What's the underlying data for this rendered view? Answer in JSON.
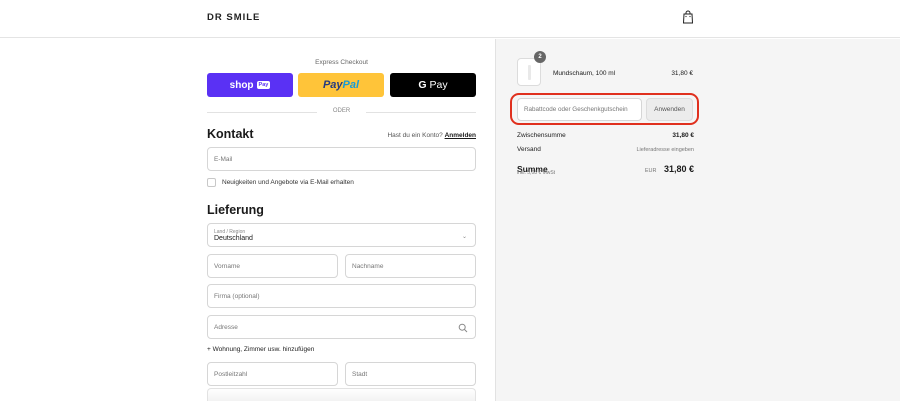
{
  "header": {
    "logo": "DR SMILE",
    "icon": "shopping-bag-icon"
  },
  "express": {
    "title": "Express Checkout",
    "shop_label": "shop",
    "shop_tag": "Pay",
    "paypal_a": "Pay",
    "paypal_b": "Pal",
    "gpay_g": "G",
    "gpay_label": "Pay",
    "divider": "ODER"
  },
  "contact": {
    "heading": "Kontakt",
    "login_prompt": "Hast du ein Konto?",
    "login_link": "Anmelden",
    "email_placeholder": "E-Mail",
    "newsletter_label": "Neuigkeiten und Angebote via E-Mail erhalten"
  },
  "delivery": {
    "heading": "Lieferung",
    "country_label": "Land / Region",
    "country_value": "Deutschland",
    "first_name": "Vorname",
    "last_name": "Nachname",
    "company": "Firma (optional)",
    "address": "Adresse",
    "add_line": "+ Wohnung, Zimmer usw. hinzufügen",
    "postal_code": "Postleitzahl",
    "city": "Stadt"
  },
  "cart": {
    "item": {
      "quantity": "2",
      "name": "Mundschaum, 100 ml",
      "price": "31,80 €"
    },
    "promo_placeholder": "Rabattcode oder Geschenkgutschein",
    "promo_button": "Anwenden",
    "subtotal_label": "Zwischensumme",
    "subtotal_value": "31,80 €",
    "shipping_label": "Versand",
    "shipping_value": "Lieferadresse eingeben",
    "total_label": "Summe",
    "tax_note": "inkl. 5,08 € MwSt",
    "currency": "EUR",
    "total_value": "31,80 €"
  },
  "colors": {
    "shop_pay": "#5a31f4",
    "paypal": "#ffc439",
    "gpay": "#000000",
    "highlight": "#e0301e"
  }
}
